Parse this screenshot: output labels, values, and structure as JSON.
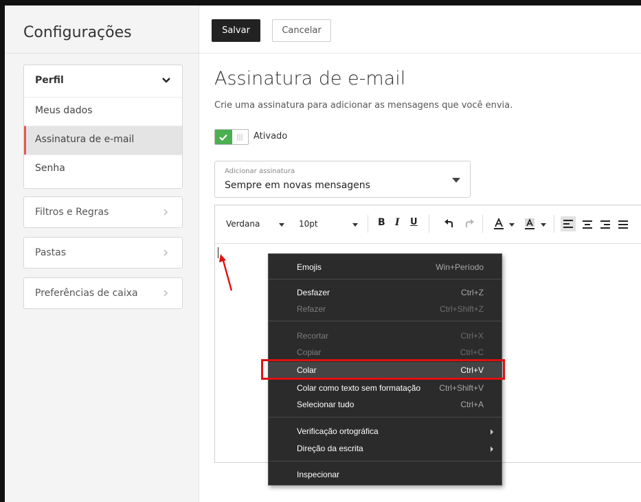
{
  "sidebar": {
    "title": "Configurações",
    "profile_group": {
      "label": "Perfil",
      "items": [
        {
          "label": "Meus dados"
        },
        {
          "label": "Assinatura de e-mail",
          "active": true
        },
        {
          "label": "Senha"
        }
      ]
    },
    "groups": [
      {
        "label": "Filtros e Regras"
      },
      {
        "label": "Pastas"
      },
      {
        "label": "Preferências de caixa"
      }
    ]
  },
  "toolbar": {
    "save_label": "Salvar",
    "cancel_label": "Cancelar"
  },
  "main": {
    "title": "Assinatura de e-mail",
    "subtitle": "Crie uma assinatura para adicionar as mensagens que você envia.",
    "toggle_label": "Ativado",
    "toggle_on": true,
    "select": {
      "label": "Adicionar assinatura",
      "value": "Sempre em novas mensagens"
    }
  },
  "editor_toolbar": {
    "font": "Verdana",
    "size": "10pt"
  },
  "context_menu": {
    "items": [
      {
        "label": "Emojis",
        "shortcut": "Win+Período"
      },
      {
        "label": "Desfazer",
        "shortcut": "Ctrl+Z"
      },
      {
        "label": "Refazer",
        "shortcut": "Ctrl+Shift+Z",
        "disabled": true
      },
      {
        "label": "Recortar",
        "shortcut": "Ctrl+X",
        "disabled": true
      },
      {
        "label": "Copiar",
        "shortcut": "Ctrl+C",
        "disabled": true
      },
      {
        "label": "Colar",
        "shortcut": "Ctrl+V",
        "highlighted": true
      },
      {
        "label": "Colar como texto sem formatação",
        "shortcut": "Ctrl+Shift+V"
      },
      {
        "label": "Selecionar tudo",
        "shortcut": "Ctrl+A"
      },
      {
        "label": "Verificação ortográfica",
        "submenu": true
      },
      {
        "label": "Direção da escrita",
        "submenu": true
      },
      {
        "label": "Inspecionar"
      }
    ]
  },
  "colors": {
    "toggle_on": "#4caf50",
    "active_marker": "#e05a4f",
    "annotation_red": "#e01010",
    "menu_bg": "#2b2b2b"
  }
}
